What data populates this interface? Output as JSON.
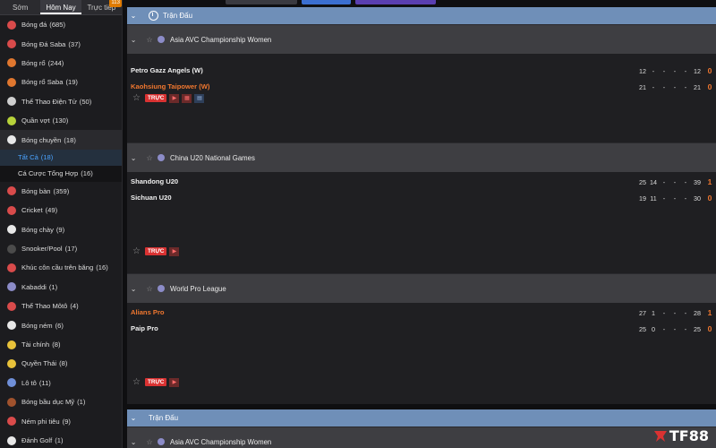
{
  "sidebar": {
    "tabs": [
      {
        "label": "Sớm"
      },
      {
        "label": "Hôm Nay"
      },
      {
        "label": "Trực tiếp",
        "badge": "113"
      }
    ],
    "sports": [
      {
        "label": "Bóng đá",
        "count": "(685)",
        "color": "#d94b4b"
      },
      {
        "label": "Bóng Đá Saba",
        "count": "(37)",
        "color": "#d94b4b"
      },
      {
        "label": "Bóng rổ",
        "count": "(244)",
        "color": "#e0772f"
      },
      {
        "label": "Bóng rổ Saba",
        "count": "(19)",
        "color": "#e0772f"
      },
      {
        "label": "Thể Thao Điện Tử",
        "count": "(50)",
        "color": "#cfcfcf"
      },
      {
        "label": "Quần vợt",
        "count": "(130)",
        "color": "#b7d23a"
      },
      {
        "label": "Bóng chuyền",
        "count": "(18)",
        "color": "#e8e8e8"
      }
    ],
    "sub_items": [
      {
        "label": "Tất Cả",
        "count": "(18)"
      },
      {
        "label": "Cá Cược Tổng Hợp",
        "count": "(16)"
      }
    ],
    "sports_after": [
      {
        "label": "Bóng bàn",
        "count": "(359)",
        "color": "#d94b4b"
      },
      {
        "label": "Cricket",
        "count": "(49)",
        "color": "#d94b4b"
      },
      {
        "label": "Bóng chày",
        "count": "(9)",
        "color": "#e8e8e8"
      },
      {
        "label": "Snooker/Pool",
        "count": "(17)",
        "color": "#4b4b4b"
      },
      {
        "label": "Khúc côn cầu trên băng",
        "count": "(16)",
        "color": "#d94b4b"
      },
      {
        "label": "Kabaddi",
        "count": "(1)",
        "color": "#8c8cc8"
      },
      {
        "label": "Thể Thao Môtô",
        "count": "(4)",
        "color": "#d94b4b"
      },
      {
        "label": "Bóng ném",
        "count": "(6)",
        "color": "#e8e8e8"
      },
      {
        "label": "Tài chính",
        "count": "(8)",
        "color": "#e8c23a"
      },
      {
        "label": "Quyền Thái",
        "count": "(8)",
        "color": "#e8c23a"
      },
      {
        "label": "Lô tô",
        "count": "(11)",
        "color": "#6f8fd8"
      },
      {
        "label": "Bóng bầu dục Mỹ",
        "count": "(1)",
        "color": "#a0522d"
      },
      {
        "label": "Ném phi tiêu",
        "count": "(9)",
        "color": "#d94b4b"
      },
      {
        "label": "Đánh Golf",
        "count": "(1)",
        "color": "#e8e8e8"
      }
    ]
  },
  "main": {
    "section_header": "Trận Đấu",
    "leagues": [
      {
        "name": "Asia AVC Championship Women",
        "live_label": "TRỰC",
        "teams": [
          {
            "name": "Petro Gazz Angels (W)",
            "color": "white",
            "scores": [
              "12",
              "-",
              "-",
              "-",
              "-",
              "12"
            ],
            "sets": "0"
          },
          {
            "name": "Kaohsiung Taipower (W)",
            "color": "orange",
            "scores": [
              "21",
              "-",
              "-",
              "-",
              "-",
              "21"
            ],
            "sets": "0"
          }
        ]
      },
      {
        "name": "China U20 National Games",
        "live_label": "TRỰC",
        "teams": [
          {
            "name": "Shandong U20",
            "color": "white",
            "scores": [
              "25",
              "14",
              "-",
              "-",
              "-",
              "39"
            ],
            "sets": "1"
          },
          {
            "name": "Sichuan U20",
            "color": "white",
            "scores": [
              "19",
              "11",
              "-",
              "-",
              "-",
              "30"
            ],
            "sets": "0"
          }
        ]
      },
      {
        "name": "World Pro League",
        "live_label": "TRỰC",
        "teams": [
          {
            "name": "Alians Pro",
            "color": "orange",
            "scores": [
              "27",
              "1",
              "-",
              "-",
              "-",
              "28"
            ],
            "sets": "1"
          },
          {
            "name": "Paip Pro",
            "color": "white",
            "scores": [
              "25",
              "0",
              "-",
              "-",
              "-",
              "25"
            ],
            "sets": "0"
          }
        ]
      }
    ],
    "second_header": "Trận Đấu",
    "second_league": "Asia AVC Championship Women"
  },
  "logo": {
    "text": "TF88",
    "color": "#d93232"
  }
}
